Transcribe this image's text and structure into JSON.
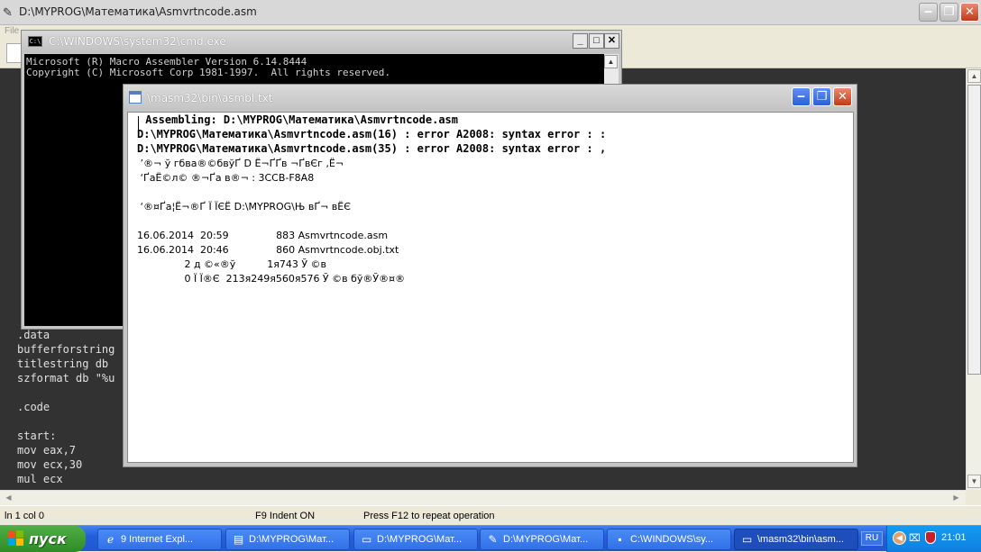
{
  "main_window": {
    "title": "D:\\MYPROG\\Математика\\Asmvrtncode.asm",
    "menu_first": "File",
    "editor_lines": [
      ".data",
      "bufferforstring",
      "titlestring db",
      "szformat db \"%u",
      "",
      ".code",
      "",
      "start:",
      "mov eax,7",
      "mov ecx,30",
      "mul ecx"
    ]
  },
  "statusbar": {
    "position": "ln 1 col 0",
    "indent": "F9 Indent ON",
    "repeat_hint": "Press F12 to repeat operation"
  },
  "cmd_window": {
    "title": "C:\\WINDOWS\\system32\\cmd.exe",
    "lines": [
      "Microsoft (R) Macro Assembler Version 6.14.8444",
      "Copyright (C) Microsoft Corp 1981-1997.  All rights reserved."
    ]
  },
  "notepad_window": {
    "title": "\\masm32\\bin\\asmbl.txt",
    "mono_lines": [
      " Assembling: D:\\MYPROG\\Математика\\Asmvrtncode.asm",
      "D:\\MYPROG\\Математика\\Asmvrtncode.asm(16) : error A2008: syntax error : :",
      "D:\\MYPROG\\Математика\\Asmvrtncode.asm(35) : error A2008: syntax error : ,"
    ],
    "garbled_lines": [
      " ’®¬ ў гбва®©бвўҐ D Ё¬ҐҐв ¬ҐвЄг ‚Ё¬",
      " ‘ҐаЁ©­л© ®¬Ґа в®¬ : 3CCB-F8A8",
      "",
      " ‘®¤Ґа¦Ё¬®Ґ Ї ЇЄЁ D:\\MYPROG\\Њ вҐ¬ вЁЄ ",
      "",
      "16.06.2014  20:59               883 Asmvrtncode.asm",
      "16.06.2014  20:46               860 Asmvrtncode.obj.txt",
      "               2 д ©«®ў          1я743 Ў ©в",
      "               0 Ї Ї®Є  213я249я560я576 Ў ©в бў®Ў®¤­®"
    ]
  },
  "taskbar": {
    "start_label": "пуск",
    "tasks": [
      {
        "label": "9 Internet Expl...",
        "icon": "internet-explorer-icon"
      },
      {
        "label": "D:\\MYPROG\\Мат...",
        "icon": "notepad-doc-icon"
      },
      {
        "label": "D:\\MYPROG\\Мат...",
        "icon": "folder-icon"
      },
      {
        "label": "D:\\MYPROG\\Мат...",
        "icon": "qeditor-icon"
      },
      {
        "label": "C:\\WINDOWS\\sy...",
        "icon": "cmd-icon"
      },
      {
        "label": "\\masm32\\bin\\asm...",
        "icon": "notepad-icon"
      }
    ],
    "language": "RU",
    "clock": "21:01"
  }
}
